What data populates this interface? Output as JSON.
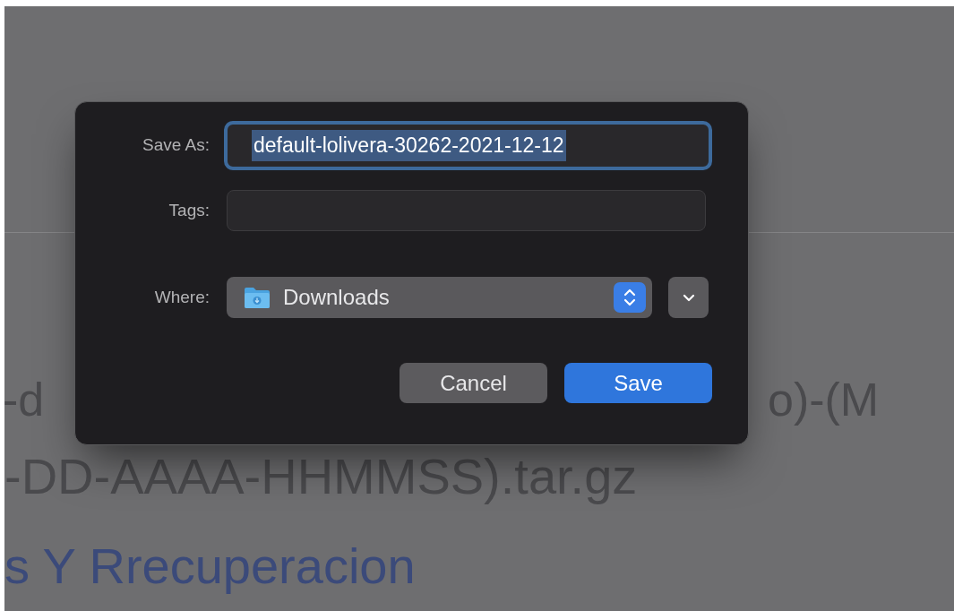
{
  "background": {
    "line_1_left": "-d",
    "line_1_right": "o)-(M",
    "line_2": "-DD-AAAA-HHMMSS).tar.gz",
    "heading": "s Y Rrecuperacion"
  },
  "dialog": {
    "save_as": {
      "label": "Save As:",
      "value": "default-lolivera-30262-2021-12-12",
      "focused": true
    },
    "tags": {
      "label": "Tags:"
    },
    "where": {
      "label": "Where:",
      "value": "Downloads"
    },
    "buttons": [
      {
        "label": "Cancel",
        "kind": "secondary"
      },
      {
        "label": "Save",
        "kind": "primary"
      }
    ]
  }
}
